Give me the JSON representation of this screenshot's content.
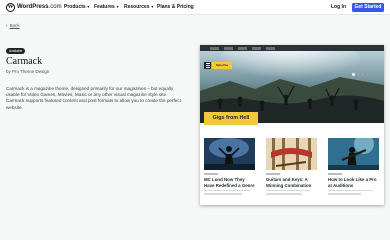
{
  "topnav": {
    "brand_bold": "WordPress",
    "brand_rest": ".com",
    "menu": [
      {
        "label": "Products",
        "has_caret": true
      },
      {
        "label": "Features",
        "has_caret": true
      },
      {
        "label": "Resources",
        "has_caret": true
      },
      {
        "label": "Plans & Pricing",
        "has_caret": false
      }
    ],
    "login_label": "Log In",
    "cta_label": "Get Started"
  },
  "back": {
    "chevron": "‹",
    "label": "Back"
  },
  "theme": {
    "badge": "Available",
    "name": "Carmack",
    "byline": "by Pro Theme Design",
    "description": "Carmack is a magazine theme, designed primarily for our magazines – but equally usable for Video Games, Movies, Music or any other visual magazine style site. Carmack supports featured content and post formats to allow you to create the perfect website."
  },
  "preview": {
    "hero_caption": "Gigs from Hell",
    "cta": "Subscribe",
    "cards": [
      {
        "title": "MC Lund Now They Have Redefined a Genre"
      },
      {
        "title": "Guitars and Keys: A Winning Combination"
      },
      {
        "title": "How to Look Like a Pro at Auditions"
      }
    ]
  },
  "colors": {
    "accent": "#3858e9",
    "highlight": "#f0c93a",
    "dark": "#1d2327"
  }
}
